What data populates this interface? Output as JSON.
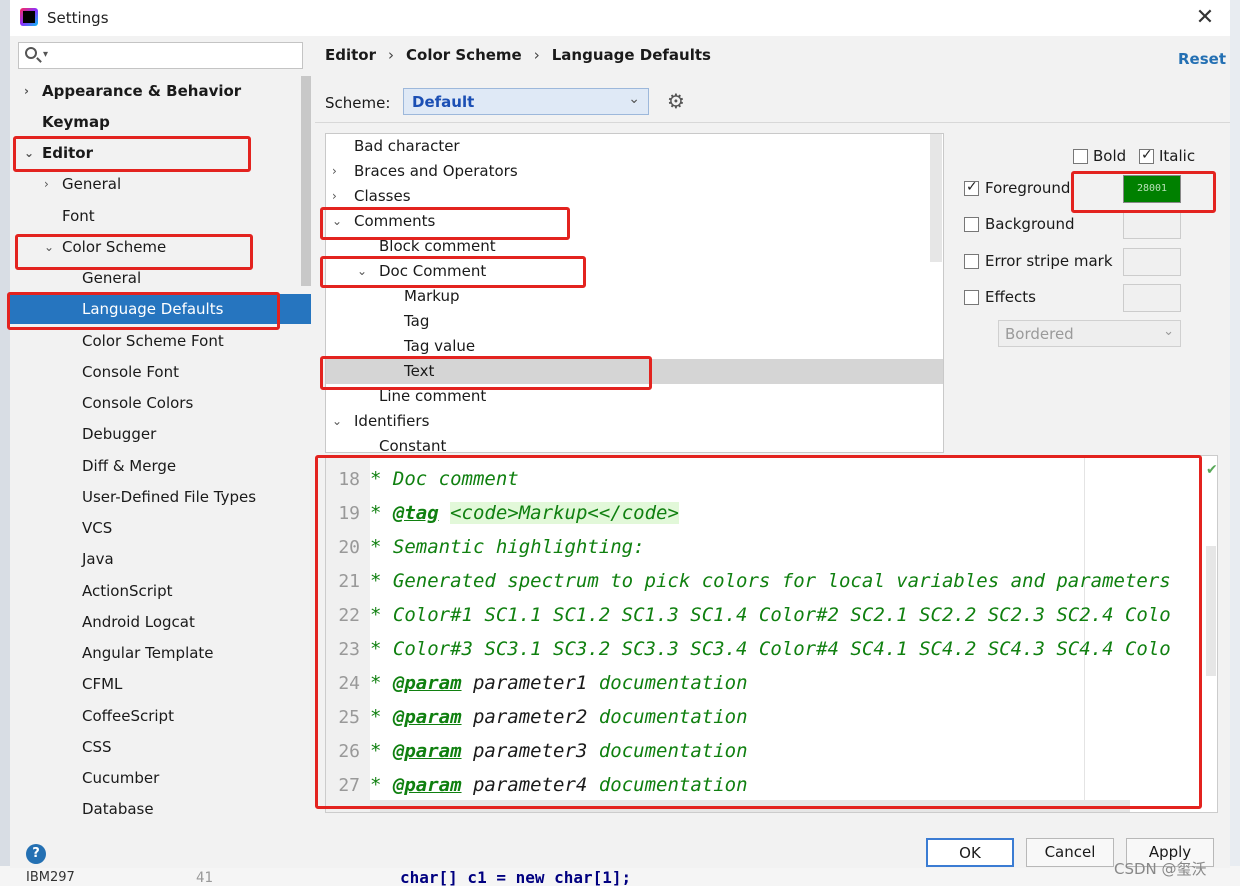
{
  "window": {
    "title": "Settings",
    "close_label": "✕"
  },
  "search": {
    "placeholder": ""
  },
  "sidebar": {
    "items": [
      {
        "label": "Appearance & Behavior",
        "bold": true,
        "chevron": "›"
      },
      {
        "label": "Keymap",
        "bold": true
      },
      {
        "label": "Editor",
        "bold": true,
        "chevron": "⌄"
      },
      {
        "label": "General",
        "chevron": "›"
      },
      {
        "label": "Font"
      },
      {
        "label": "Color Scheme",
        "chevron": "⌄"
      },
      {
        "label": "General"
      },
      {
        "label": "Language Defaults",
        "selected": true
      },
      {
        "label": "Color Scheme Font"
      },
      {
        "label": "Console Font"
      },
      {
        "label": "Console Colors"
      },
      {
        "label": "Debugger"
      },
      {
        "label": "Diff & Merge"
      },
      {
        "label": "User-Defined File Types"
      },
      {
        "label": "VCS"
      },
      {
        "label": "Java"
      },
      {
        "label": "ActionScript"
      },
      {
        "label": "Android Logcat"
      },
      {
        "label": "Angular Template"
      },
      {
        "label": "CFML"
      },
      {
        "label": "CoffeeScript"
      },
      {
        "label": "CSS"
      },
      {
        "label": "Cucumber"
      },
      {
        "label": "Database"
      }
    ]
  },
  "breadcrumb": {
    "part1": "Editor",
    "part2": "Color Scheme",
    "part3": "Language Defaults",
    "sep": "›"
  },
  "reset_label": "Reset",
  "scheme": {
    "label": "Scheme:",
    "value": "Default"
  },
  "attributes": [
    {
      "label": "Bad character"
    },
    {
      "label": "Braces and Operators",
      "chevron": "›"
    },
    {
      "label": "Classes",
      "chevron": "›"
    },
    {
      "label": "Comments",
      "chevron": "⌄"
    },
    {
      "label": "Block comment"
    },
    {
      "label": "Doc Comment",
      "chevron": "⌄"
    },
    {
      "label": "Markup"
    },
    {
      "label": "Tag"
    },
    {
      "label": "Tag value"
    },
    {
      "label": "Text",
      "selected": true
    },
    {
      "label": "Line comment"
    },
    {
      "label": "Identifiers",
      "chevron": "⌄"
    },
    {
      "label": "Constant"
    }
  ],
  "options": {
    "bold_label": "Bold",
    "italic_label": "Italic",
    "foreground_label": "Foreground",
    "foreground_value": "28001",
    "background_label": "Background",
    "error_stripe_label": "Error stripe mark",
    "effects_label": "Effects",
    "effects_value": "Bordered",
    "bold_checked": false,
    "italic_checked": true,
    "foreground_checked": true,
    "background_checked": false,
    "error_stripe_checked": false,
    "effects_checked": false,
    "foreground_color": "#008000"
  },
  "preview": {
    "lines": [
      {
        "num": "18",
        "text": "* Doc comment"
      },
      {
        "num": "19",
        "prefix": "* ",
        "tag": "@tag",
        "markup": "<code>Markup<</code>"
      },
      {
        "num": "20",
        "text": "* Semantic highlighting:"
      },
      {
        "num": "21",
        "text": "* Generated spectrum to pick colors for local variables and parameters"
      },
      {
        "num": "22",
        "text": "*  Color#1 SC1.1 SC1.2 SC1.3 SC1.4 Color#2 SC2.1 SC2.2 SC2.3 SC2.4 Colo"
      },
      {
        "num": "23",
        "text": "*  Color#3 SC3.1 SC3.2 SC3.3 SC3.4 Color#4 SC4.1 SC4.2 SC4.3 SC4.4 Colo"
      },
      {
        "num": "24",
        "prefix": "* ",
        "tag": "@param",
        "param": "parameter1",
        "rest": "documentation"
      },
      {
        "num": "25",
        "prefix": "* ",
        "tag": "@param",
        "param": "parameter2",
        "rest": "documentation"
      },
      {
        "num": "26",
        "prefix": "* ",
        "tag": "@param",
        "param": "parameter3",
        "rest": "documentation"
      },
      {
        "num": "27",
        "prefix": "* ",
        "tag": "@param",
        "param": "parameter4",
        "rest": "documentation"
      }
    ]
  },
  "buttons": {
    "ok": "OK",
    "cancel": "Cancel",
    "apply": "Apply",
    "help": "?"
  },
  "background": {
    "ibm": "IBM297",
    "line_num": "41",
    "code": "char[] c1 = new char[1];"
  },
  "watermark": "CSDN @玺沃",
  "colors": {
    "accent": "#2675bf",
    "annotation": "#e3231f",
    "comment_green": "#108010"
  }
}
